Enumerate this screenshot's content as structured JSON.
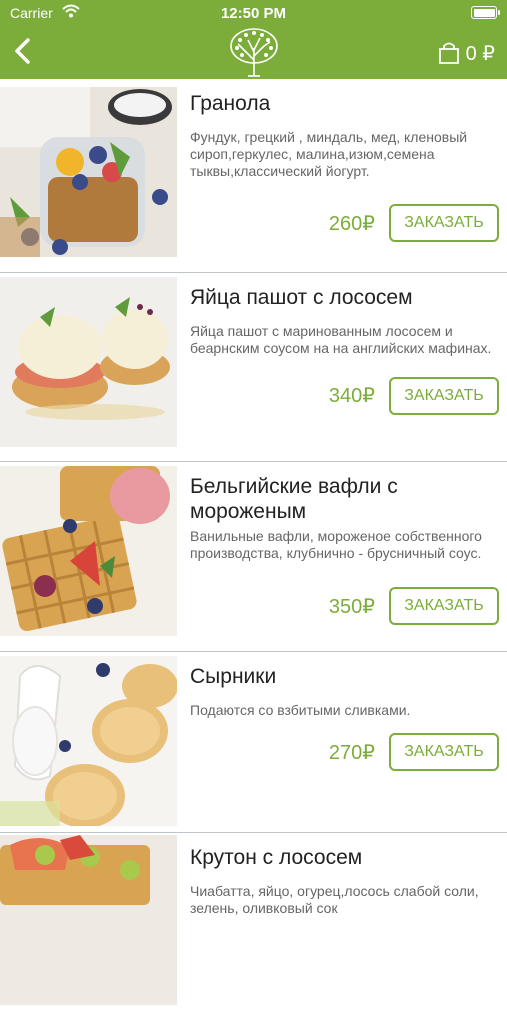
{
  "status": {
    "carrier": "Carrier",
    "time": "12:50 PM"
  },
  "header": {
    "cart_amount": "0 ₽"
  },
  "items": [
    {
      "title": "Гранола",
      "desc": "Фундук, грецкий , миндаль, мед, кленовый сироп,геркулес, малина,изюм,семена тыквы,классический йогурт.",
      "price": "260₽",
      "order": "ЗАКАЗАТЬ"
    },
    {
      "title": "Яйца пашот с лососем",
      "desc": "Яйца пашот с маринованным лососем и беарнским соусом на  на английских мафинах.",
      "price": "340₽",
      "order": "ЗАКАЗАТЬ"
    },
    {
      "title": "Бельгийские вафли с мороженым",
      "desc": "Ванильные вафли, мороженое собственного производства, клубнично - брусничный соус.",
      "price": "350₽",
      "order": "ЗАКАЗАТЬ"
    },
    {
      "title": "Сырники",
      "desc": "Подаются со взбитыми сливками.",
      "price": "270₽",
      "order": "ЗАКАЗАТЬ"
    },
    {
      "title": "Крутон с лососем",
      "desc": "Чиабатта, яйцо, огурец,лосось слабой соли, зелень, оливковый сок",
      "price": "",
      "order": ""
    }
  ],
  "colors": {
    "brand": "#7cad3a",
    "divider": "#bfc4c8"
  }
}
